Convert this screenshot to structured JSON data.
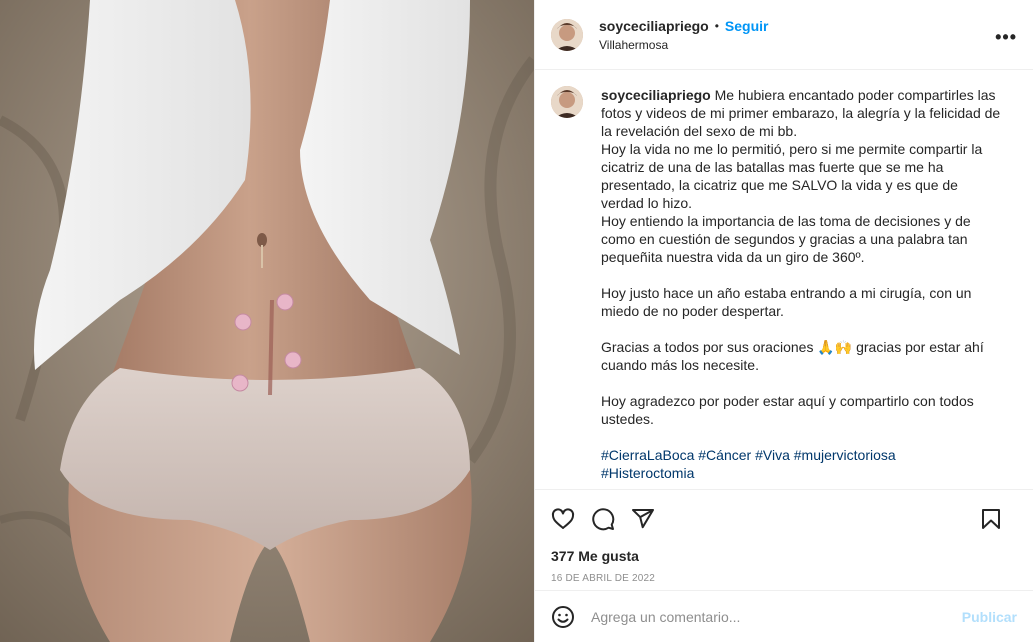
{
  "header": {
    "username": "soyceciliapriego",
    "separator": "•",
    "follow_label": "Seguir",
    "location": "Villahermosa",
    "more_label": "•••"
  },
  "caption": {
    "username": "soyceciliapriego",
    "text": " Me hubiera encantado poder compartirles las fotos y videos de mi primer embarazo, la alegría y la felicidad de la revelación del sexo de mi bb.\nHoy la vida no me lo permitió, pero si me permite compartir la cicatriz de una de las batallas mas fuerte que se me ha presentado, la cicatriz que me SALVO la vida y es que de verdad lo hizo.\nHoy entiendo la importancia de las toma de decisiones y de como en cuestión de segundos y gracias a una palabra tan pequeñita nuestra vida da un giro de 360º.\n\nHoy justo hace un año estaba entrando a mi cirugía, con un miedo de no poder despertar.\n\nGracias a todos por sus oraciones 🙏🙌 gracias por estar ahí cuando más los necesite.\n\nHoy agradezco por poder estar aquí y compartirlo con todos ustedes.\n\n",
    "hashtags": "#CierraLaBoca #Cáncer #Viva #mujervictoriosa\n#Histeroctomia"
  },
  "actions": {
    "icons": [
      "heart-icon",
      "comment-icon",
      "share-icon",
      "bookmark-icon"
    ]
  },
  "likes": "377 Me gusta",
  "date": "16 DE ABRIL DE 2022",
  "comment": {
    "placeholder": "Agrega un comentario...",
    "publish_label": "Publicar"
  },
  "colors": {
    "accent": "#0095f6",
    "hashtag": "#00376b",
    "publish_disabled": "#b2dffc",
    "muted": "#8e8e8e"
  }
}
